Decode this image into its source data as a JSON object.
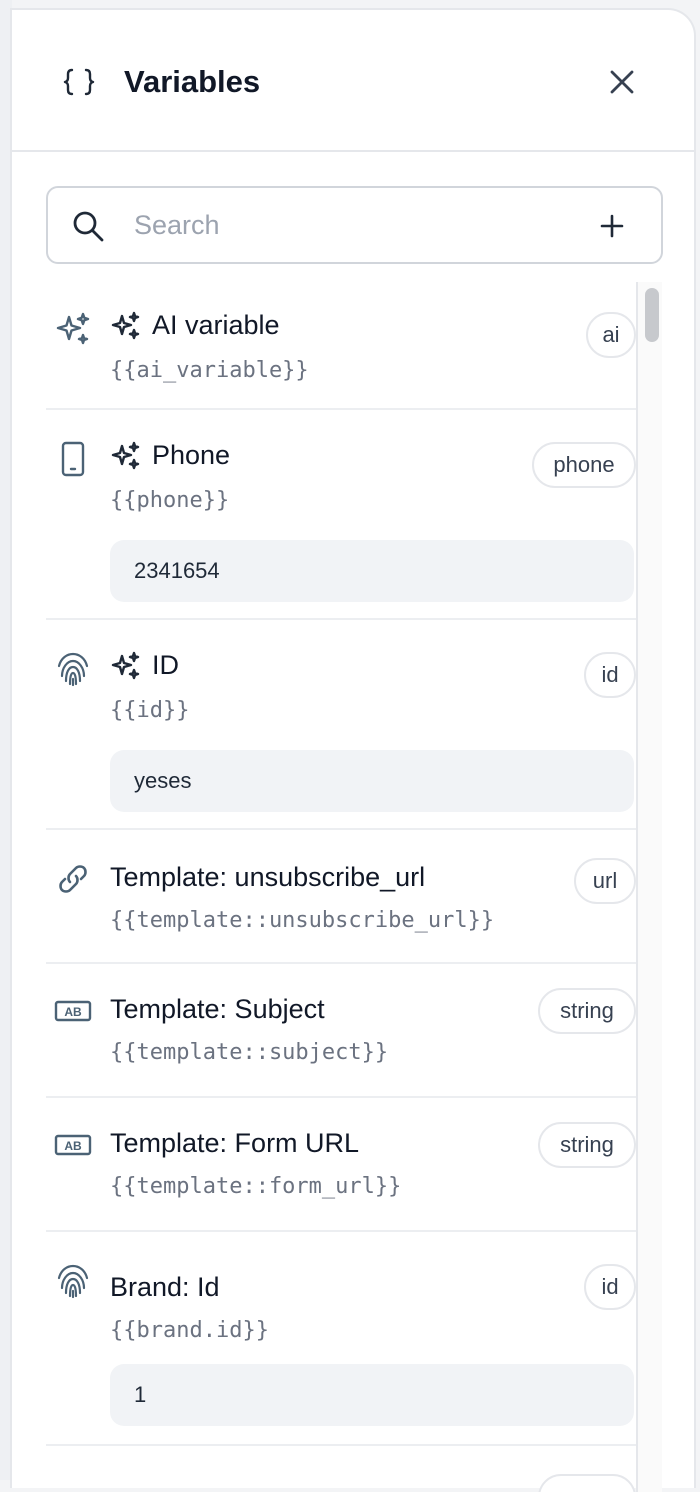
{
  "panel": {
    "title": "Variables",
    "header_icon": "braces-icon",
    "close_icon": "close-icon"
  },
  "search": {
    "placeholder": "Search",
    "value": "",
    "search_icon": "search-icon",
    "add_icon": "plus-icon"
  },
  "variables": [
    {
      "title": "AI variable",
      "code": "{{ai_variable}}",
      "badge": "ai",
      "icon": "sparkles-icon",
      "ai": true,
      "value": null
    },
    {
      "title": "Phone",
      "code": "{{phone}}",
      "badge": "phone",
      "icon": "phone-icon",
      "ai": true,
      "value": "2341654"
    },
    {
      "title": "ID",
      "code": "{{id}}",
      "badge": "id",
      "icon": "fingerprint-icon",
      "ai": true,
      "value": "yeses"
    },
    {
      "title": "Template: unsubscribe_url",
      "code": "{{template::unsubscribe_url}}",
      "badge": "url",
      "icon": "link-icon",
      "ai": false,
      "value": null
    },
    {
      "title": "Template: Subject",
      "code": "{{template::subject}}",
      "badge": "string",
      "icon": "text-ab-icon",
      "ai": false,
      "value": null
    },
    {
      "title": "Template: Form URL",
      "code": "{{template::form_url}}",
      "badge": "string",
      "icon": "text-ab-icon",
      "ai": false,
      "value": null
    },
    {
      "title": "Brand: Id",
      "code": "{{brand.id}}",
      "badge": "id",
      "icon": "fingerprint-icon",
      "ai": false,
      "value": "1"
    }
  ],
  "colors": {
    "icon_slate": "#4b6275",
    "text": "#111827",
    "muted": "#6b7280",
    "value_bg": "#f1f3f6",
    "border": "#e5e7eb"
  }
}
